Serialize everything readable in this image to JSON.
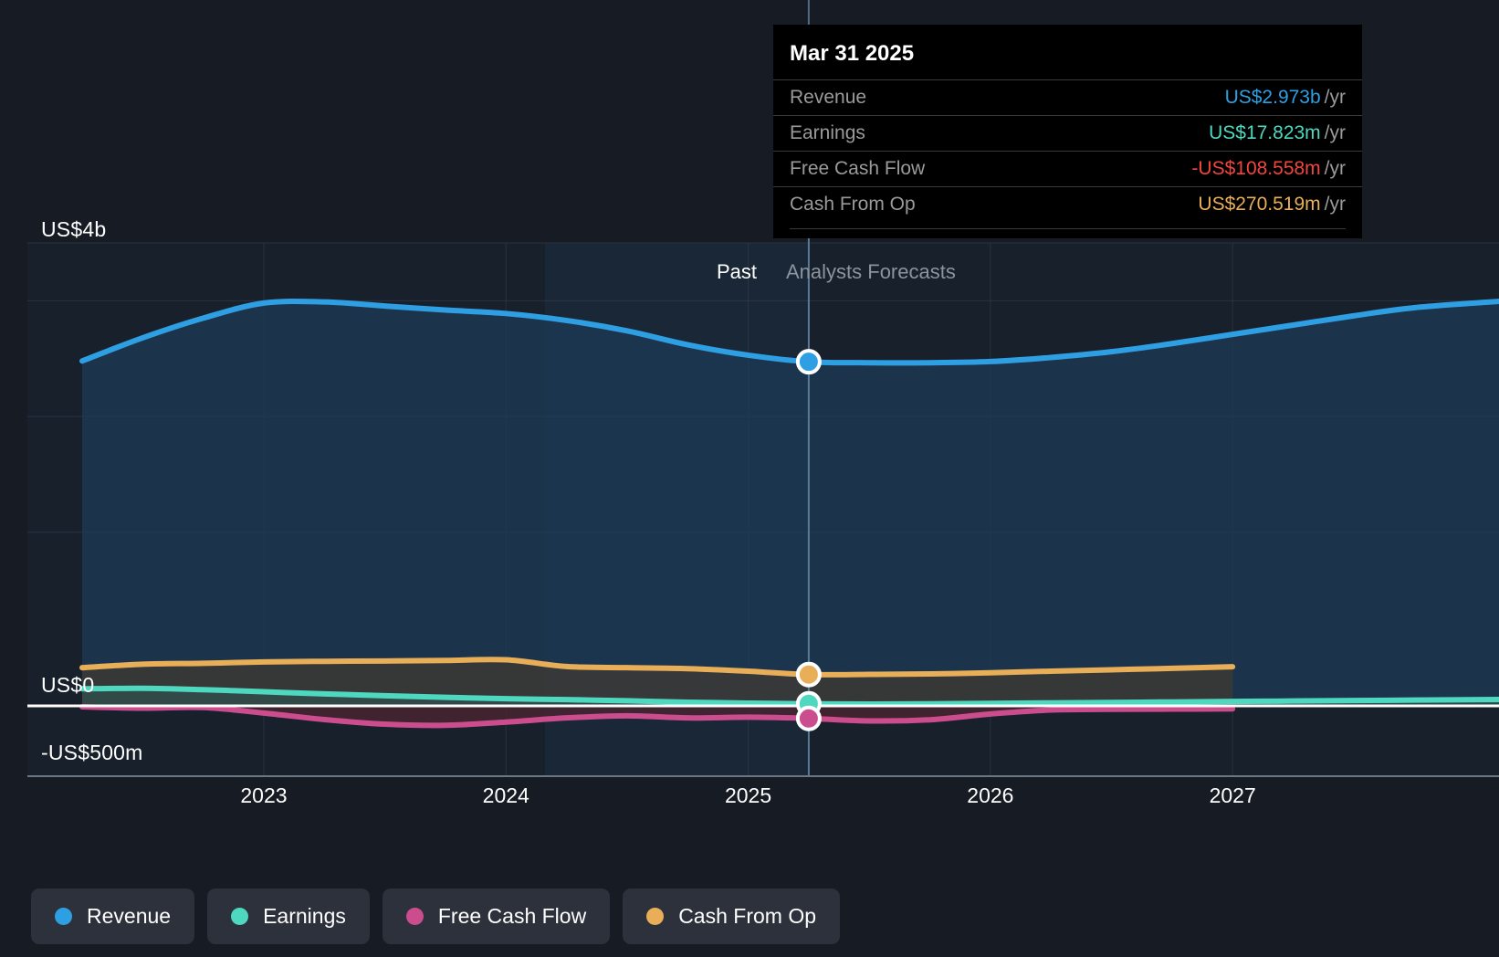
{
  "theme": {
    "page_background": "#171c24",
    "plot_background": "#18202c",
    "past_region_background": "#1b2a3a",
    "gridline_color": "#3a4450",
    "zero_line_color": "#ffffff",
    "divider_color": "#5b7a96",
    "tooltip_background": "#000000",
    "legend_chip_background": "#2c313c",
    "muted_text": "#8b949e"
  },
  "tooltip": {
    "title": "Mar 31 2025",
    "rows": [
      {
        "label": "Revenue",
        "value": "US$2.973b",
        "unit": "/yr",
        "color": "#2f9fe3"
      },
      {
        "label": "Earnings",
        "value": "US$17.823m",
        "unit": "/yr",
        "color": "#4fd8c0"
      },
      {
        "label": "Free Cash Flow",
        "value": "-US$108.558m",
        "unit": "/yr",
        "color": "#f2453d"
      },
      {
        "label": "Cash From Op",
        "value": "US$270.519m",
        "unit": "/yr",
        "color": "#e9ae58"
      }
    ]
  },
  "annotations": {
    "past": "Past",
    "forecast": "Analysts Forecasts"
  },
  "legend": {
    "items": [
      {
        "label": "Revenue",
        "color": "#2f9fe3"
      },
      {
        "label": "Earnings",
        "color": "#4fd8c0"
      },
      {
        "label": "Free Cash Flow",
        "color": "#cc4d8e"
      },
      {
        "label": "Cash From Op",
        "color": "#e9ae58"
      }
    ]
  },
  "chart_data": {
    "type": "area",
    "title": "",
    "xlabel": "",
    "ylabel": "",
    "currency": "USD",
    "grid": true,
    "legend_position": "bottom-left",
    "ylim": [
      -500000000,
      4000000000
    ],
    "y_ticks": [
      {
        "value": 4000000000,
        "label": "US$4b"
      },
      {
        "value": 0,
        "label": "US$0"
      },
      {
        "value": -500000000,
        "label": "-US$500m"
      }
    ],
    "y_tick_labels": [
      "US$4b",
      "US$0",
      "-US$500m"
    ],
    "x_ticks": [
      "2023",
      "2024",
      "2025",
      "2026",
      "2027"
    ],
    "x_tick_years": [
      2023,
      2024,
      2025,
      2026,
      2027
    ],
    "xlim": [
      2022.25,
      2028.1
    ],
    "divider": {
      "label": "Mar 31 2025",
      "x": 2025.25
    },
    "marker_values": {
      "Revenue": "US$2.973b",
      "Earnings": "US$17.823m",
      "Free Cash Flow": "-US$108.558m",
      "Cash From Op": "US$270.519m"
    },
    "series": [
      {
        "name": "Revenue",
        "color": "#2f9fe3",
        "fill": "#1d3a55",
        "x": [
          2022.25,
          2022.5,
          2022.75,
          2023.0,
          2023.25,
          2023.5,
          2023.75,
          2024.0,
          2024.25,
          2024.5,
          2024.75,
          2025.0,
          2025.25,
          2025.5,
          2025.75,
          2026.0,
          2026.25,
          2026.5,
          2026.75,
          2027.0,
          2027.25,
          2027.5,
          2027.75,
          2028.1
        ],
        "values": [
          2980000000,
          3180000000,
          3350000000,
          3480000000,
          3490000000,
          3455000000,
          3420000000,
          3390000000,
          3330000000,
          3240000000,
          3120000000,
          3030000000,
          2973000000,
          2965000000,
          2965000000,
          2975000000,
          3010000000,
          3060000000,
          3130000000,
          3210000000,
          3290000000,
          3370000000,
          3440000000,
          3495000000
        ]
      },
      {
        "name": "Earnings",
        "color": "#4fd8c0",
        "fill": "#2f4f4d",
        "x": [
          2022.25,
          2022.5,
          2022.75,
          2023.0,
          2023.25,
          2023.5,
          2023.75,
          2024.0,
          2024.25,
          2024.5,
          2024.75,
          2025.0,
          2025.25,
          2025.5,
          2025.75,
          2026.0,
          2026.25,
          2026.5,
          2026.75,
          2027.0,
          2027.25,
          2027.5,
          2027.75,
          2028.1
        ],
        "values": [
          148000000,
          152000000,
          140000000,
          122000000,
          104000000,
          88000000,
          74000000,
          62000000,
          54000000,
          44000000,
          32000000,
          24000000,
          17823000,
          16000000,
          18000000,
          22000000,
          26000000,
          30000000,
          34000000,
          38000000,
          42000000,
          46000000,
          50000000,
          55000000
        ]
      },
      {
        "name": "Free Cash Flow",
        "color": "#cc4d8e",
        "fill": "#4a2430",
        "x": [
          2022.25,
          2022.5,
          2022.75,
          2023.0,
          2023.25,
          2023.5,
          2023.75,
          2024.0,
          2024.25,
          2024.5,
          2024.75,
          2025.0,
          2025.25,
          2025.5,
          2025.75,
          2026.0,
          2026.25,
          2026.5,
          2026.75,
          2027.0
        ],
        "values": [
          -8000000,
          -20000000,
          -14000000,
          -62000000,
          -118000000,
          -158000000,
          -168000000,
          -140000000,
          -104000000,
          -86000000,
          -104000000,
          -98000000,
          -108558000,
          -130000000,
          -120000000,
          -70000000,
          -36000000,
          -30000000,
          -28000000,
          -26000000
        ]
      },
      {
        "name": "Cash From Op",
        "color": "#e9ae58",
        "fill": "#3d3a33",
        "x": [
          2022.25,
          2022.5,
          2022.75,
          2023.0,
          2023.25,
          2023.5,
          2023.75,
          2024.0,
          2024.25,
          2024.5,
          2024.75,
          2025.0,
          2025.25,
          2025.5,
          2025.75,
          2026.0,
          2026.25,
          2026.5,
          2026.75,
          2027.0
        ],
        "values": [
          330000000,
          360000000,
          368000000,
          380000000,
          385000000,
          388000000,
          392000000,
          398000000,
          340000000,
          330000000,
          322000000,
          300000000,
          270519000,
          272000000,
          276000000,
          286000000,
          300000000,
          312000000,
          324000000,
          338000000
        ]
      }
    ]
  }
}
